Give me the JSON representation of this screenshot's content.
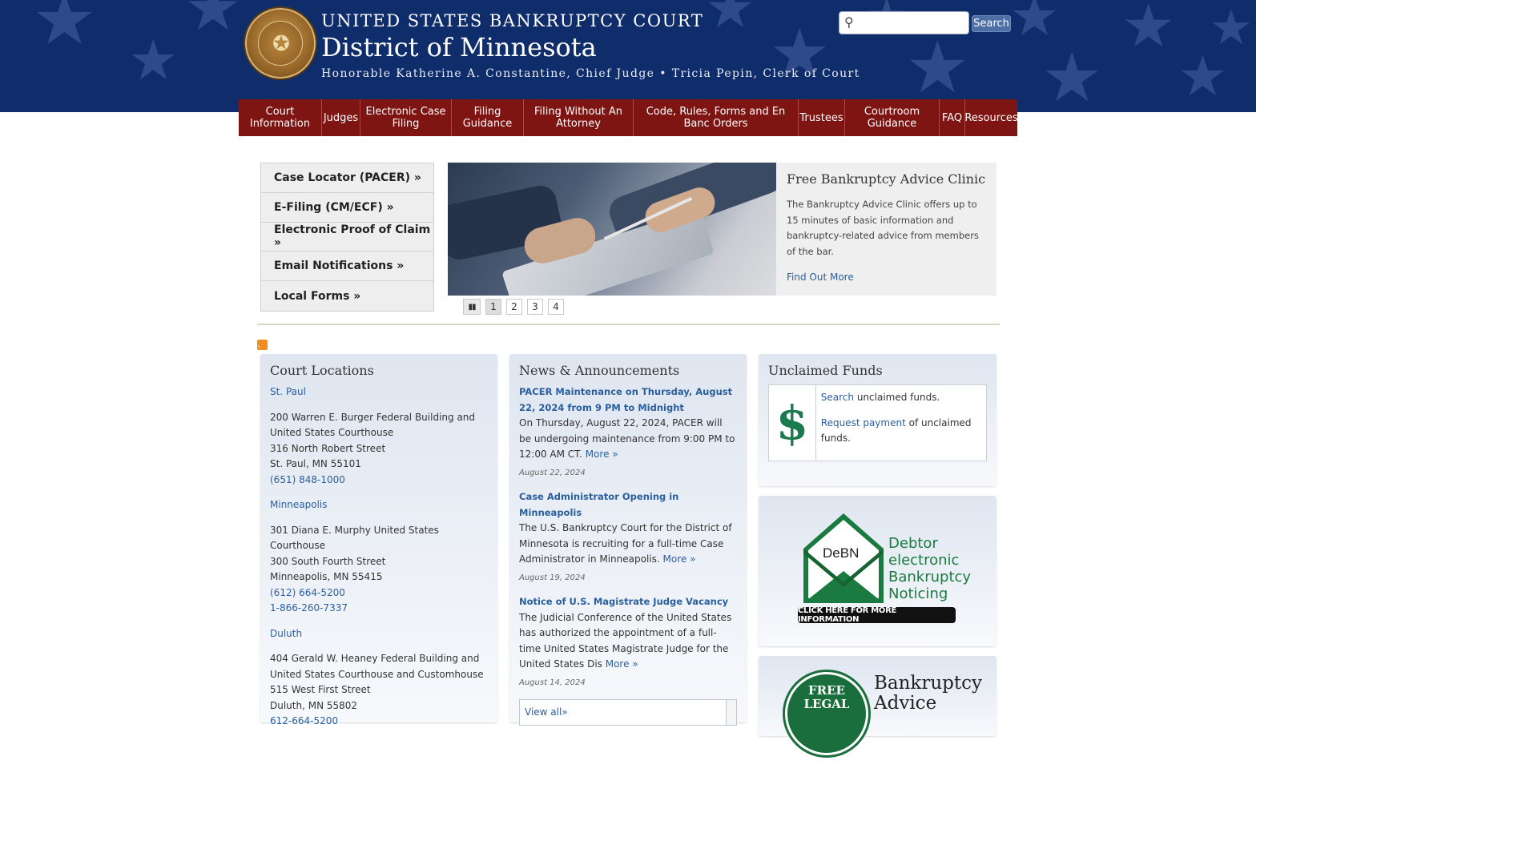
{
  "header": {
    "title": "UNITED STATES BANKRUPTCY COURT",
    "district": "District of Minnesota",
    "judges": "Honorable Katherine A. Constantine, Chief Judge • Tricia Pepin, Clerk of Court",
    "search_placeholder": "",
    "search_button": "Search"
  },
  "nav": [
    "Court Information",
    "Judges",
    "Electronic Case Filing",
    "Filing Guidance",
    "Filing Without An Attorney",
    "Code, Rules, Forms and En Banc Orders",
    "Trustees",
    "Courtroom Guidance",
    "FAQ",
    "Resources"
  ],
  "quick_links": [
    "Case Locator (PACER) »",
    "E-Filing (CM/ECF) »",
    "Electronic Proof of Claim »",
    "Email Notifications »",
    "Local Forms »"
  ],
  "slideshow": {
    "title": "Free Bankruptcy Advice Clinic",
    "text": "The Bankruptcy Advice Clinic offers up to 15 minutes of basic information and bankruptcy-related advice from members of the bar.",
    "link": "Find Out More",
    "pages": [
      "1",
      "2",
      "3",
      "4"
    ],
    "active_page": "1"
  },
  "locations": {
    "heading": "Court Locations",
    "stpaul": {
      "name": "St. Paul",
      "line1": "200 Warren E. Burger Federal Building and United States Courthouse",
      "line2": "316 North Robert Street",
      "line3": "St. Paul, MN 55101",
      "phone": "(651) 848-1000"
    },
    "minneapolis": {
      "name": "Minneapolis",
      "line1": "301 Diana E. Murphy United States Courthouse",
      "line2": "300 South Fourth Street",
      "line3": "Minneapolis, MN 55415",
      "phone": "(612) 664-5200",
      "phone2": "1-866-260-7337"
    },
    "duluth": {
      "name": "Duluth",
      "line1": "404 Gerald W. Heaney Federal Building and United States Courthouse and Customhouse",
      "line2": "515 West First Street",
      "line3": "Duluth, MN 55802",
      "phone": "612-664-5200"
    }
  },
  "news": {
    "heading": "News & Announcements",
    "items": [
      {
        "title": "PACER Maintenance on Thursday, August 22, 2024 from 9 PM to Midnight",
        "body": "On Thursday, August 22, 2024, PACER will be undergoing maintenance from 9:00 PM to 12:00 AM CT.",
        "more": "More »",
        "date": "August 22, 2024"
      },
      {
        "title": "Case Administrator Opening in Minneapolis",
        "body": "The U.S. Bankruptcy Court for the District of Minnesota is recruiting for a full-time Case Administrator in Minneapolis.",
        "more": "More »",
        "date": "August 19, 2024"
      },
      {
        "title": "Notice of U.S. Magistrate Judge Vacancy",
        "body": "The Judicial Conference of the United States has authorized the appointment of a full-time United States Magistrate Judge for the United States Dis",
        "more": "More »",
        "date": "August 14, 2024"
      }
    ],
    "view_all": "View all»"
  },
  "funds": {
    "heading": "Unclaimed Funds",
    "symbol": "$",
    "search_link": "Search",
    "search_rest": " unclaimed funds.",
    "request_link": "Request payment",
    "request_rest": " of unclaimed funds."
  },
  "debn": {
    "badge": "DeBN",
    "w1a": "D",
    "w1b": "ebtor",
    "w2a": "e",
    "w2b": "lectronic",
    "w3a": "B",
    "w3b": "ankruptcy",
    "w4a": "N",
    "w4b": "oticing",
    "cta": "CLICK HERE FOR MORE INFORMATION"
  },
  "advice": {
    "seal_line1": "FREE",
    "seal_line2": "LEGAL",
    "title_line1": "Bankruptcy",
    "title_line2": "Advice"
  },
  "colors": {
    "header_bg": "#0f2c6b",
    "nav_bg": "#7f1513",
    "link": "#2a5f9e",
    "green": "#1a7a3f"
  }
}
